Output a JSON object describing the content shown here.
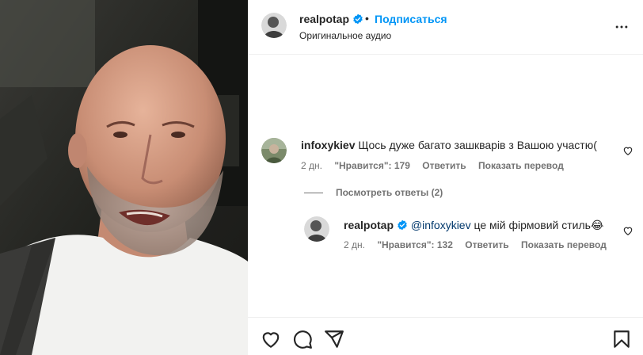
{
  "post": {
    "username": "realpotap",
    "separator": "•",
    "follow_label": "Подписаться",
    "audio_label": "Оригинальное аудио"
  },
  "comments": [
    {
      "username": "infoxykiev",
      "text": "Щось дуже багато зашкварів з Вашою участю(",
      "time": "2 дн.",
      "likes": "\"Нравится\": 179",
      "reply_label": "Ответить",
      "translate_label": "Показать перевод"
    }
  ],
  "view_replies_label": "Посмотреть ответы (2)",
  "replies": [
    {
      "username": "realpotap",
      "mention": "@infoxykiev",
      "text": " це мій фірмовий стиль😂",
      "time": "2 дн.",
      "likes": "\"Нравится\": 132",
      "reply_label": "Ответить",
      "translate_label": "Показать перевод"
    }
  ],
  "icons": {
    "verified": "verified-badge-icon",
    "more": "more-options-icon",
    "like": "heart-icon",
    "comment": "comment-icon",
    "share": "share-icon",
    "save": "bookmark-icon"
  },
  "colors": {
    "accent": "#0095f6",
    "mention": "#00376b",
    "secondary_text": "#737373"
  }
}
